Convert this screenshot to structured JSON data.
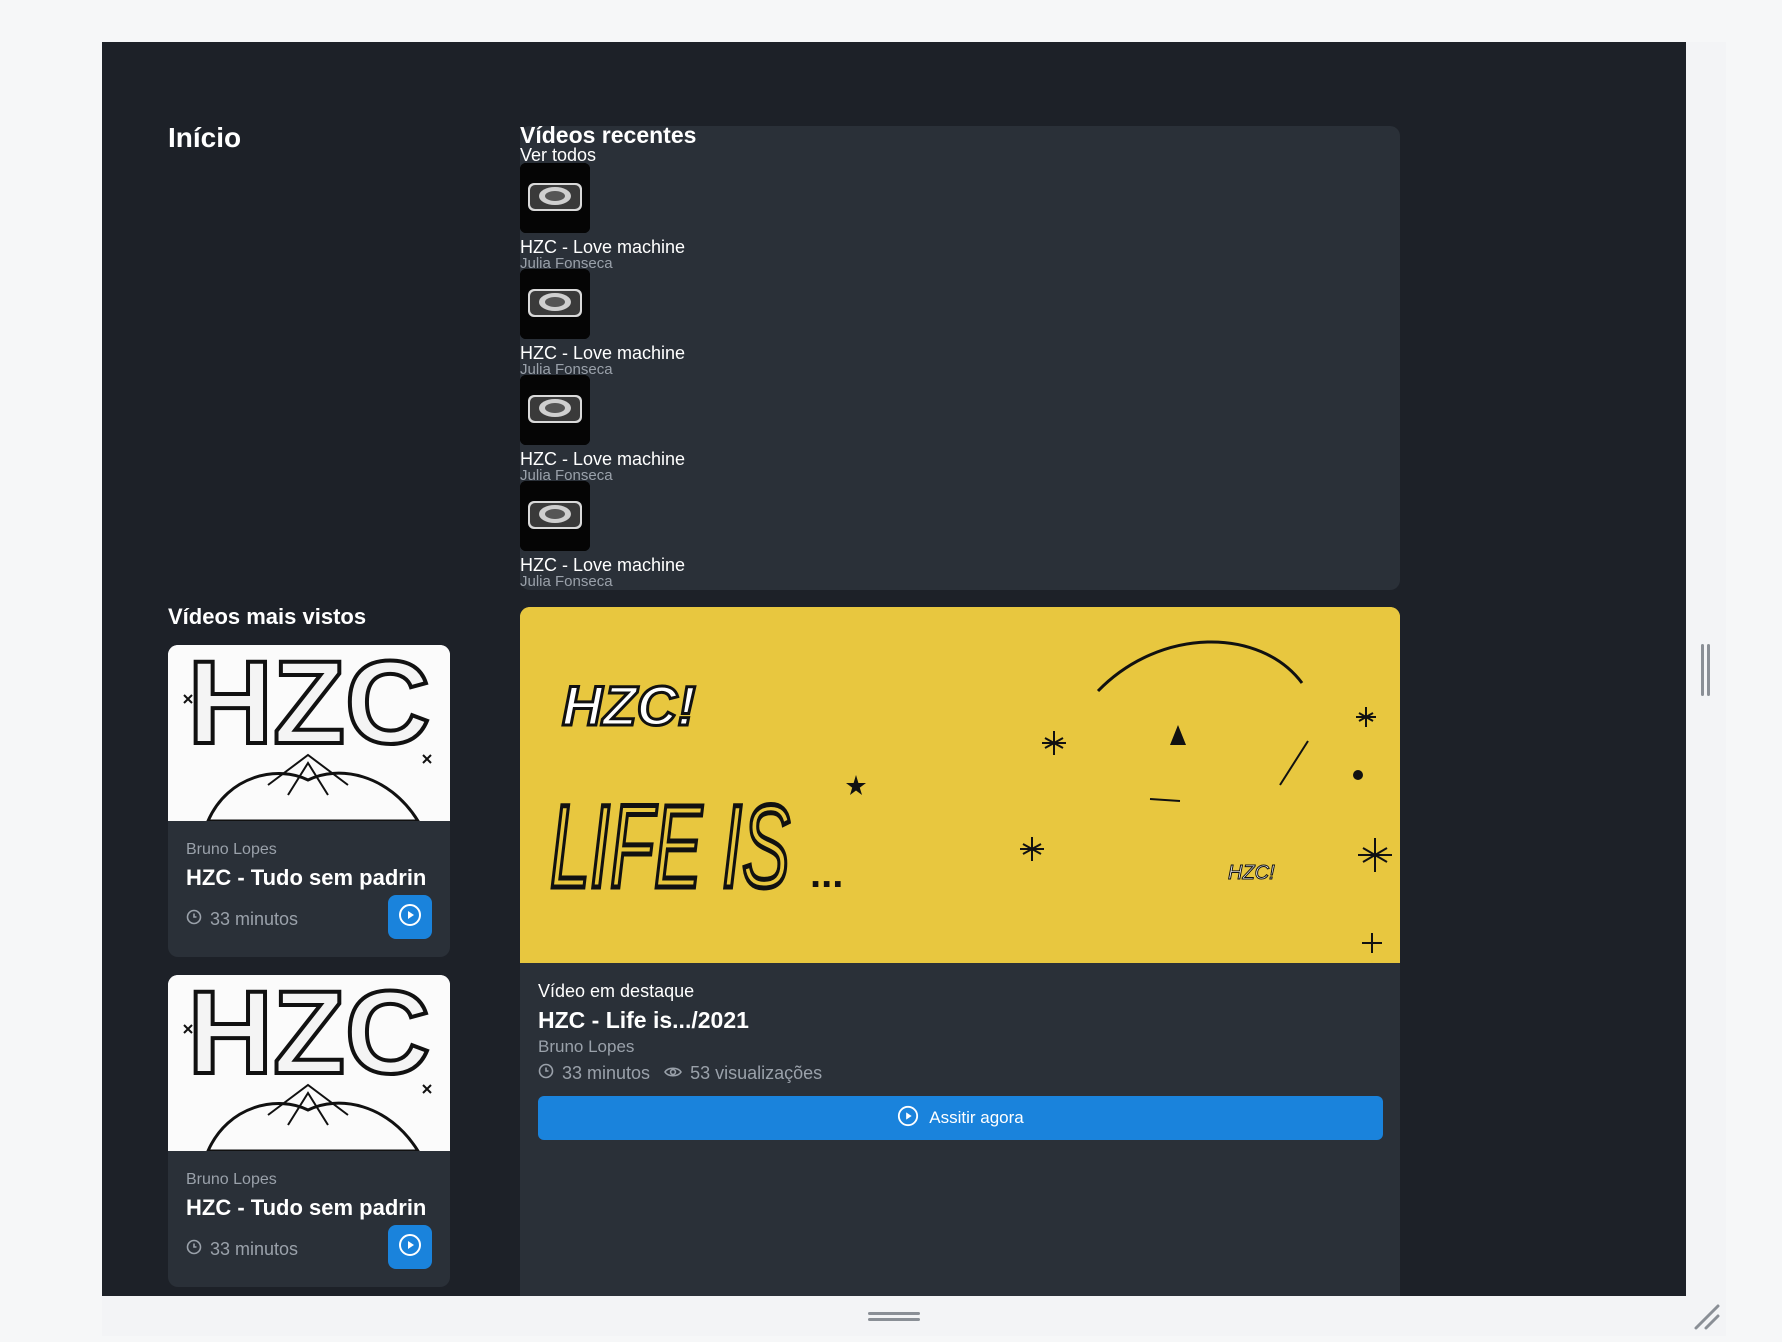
{
  "page": {
    "title": "Início"
  },
  "recent": {
    "title": "Vídeos recentes",
    "see_all": "Ver todos",
    "items": [
      {
        "title": "HZC - Love machine",
        "author": "Julia Fonseca"
      },
      {
        "title": "HZC - Love machine",
        "author": "Julia Fonseca"
      },
      {
        "title": "HZC - Love machine",
        "author": "Julia Fonseca"
      },
      {
        "title": "HZC - Love machine",
        "author": "Julia Fonseca"
      }
    ]
  },
  "most_viewed": {
    "title": "Vídeos mais vistos",
    "cards": [
      {
        "author": "Bruno Lopes",
        "title": "HZC - Tudo sem padrin",
        "duration": "33 minutos",
        "thumb_text": "HZC"
      },
      {
        "author": "Bruno Lopes",
        "title": "HZC - Tudo sem padrin",
        "duration": "33 minutos",
        "thumb_text": "HZC"
      }
    ]
  },
  "featured": {
    "label": "Vídeo em destaque",
    "title": "HZC - Life is.../2021",
    "author": "Bruno Lopes",
    "duration": "33 minutos",
    "views": "53 visualizações",
    "watch_label": "Assitir agora",
    "art_text": "LIFE IS",
    "art_dots": "...",
    "art_logo": "HZC!"
  },
  "colors": {
    "background": "#1d2128",
    "panel": "#2a3038",
    "accent": "#1a83dc",
    "featured_bg": "#e8c73f"
  }
}
